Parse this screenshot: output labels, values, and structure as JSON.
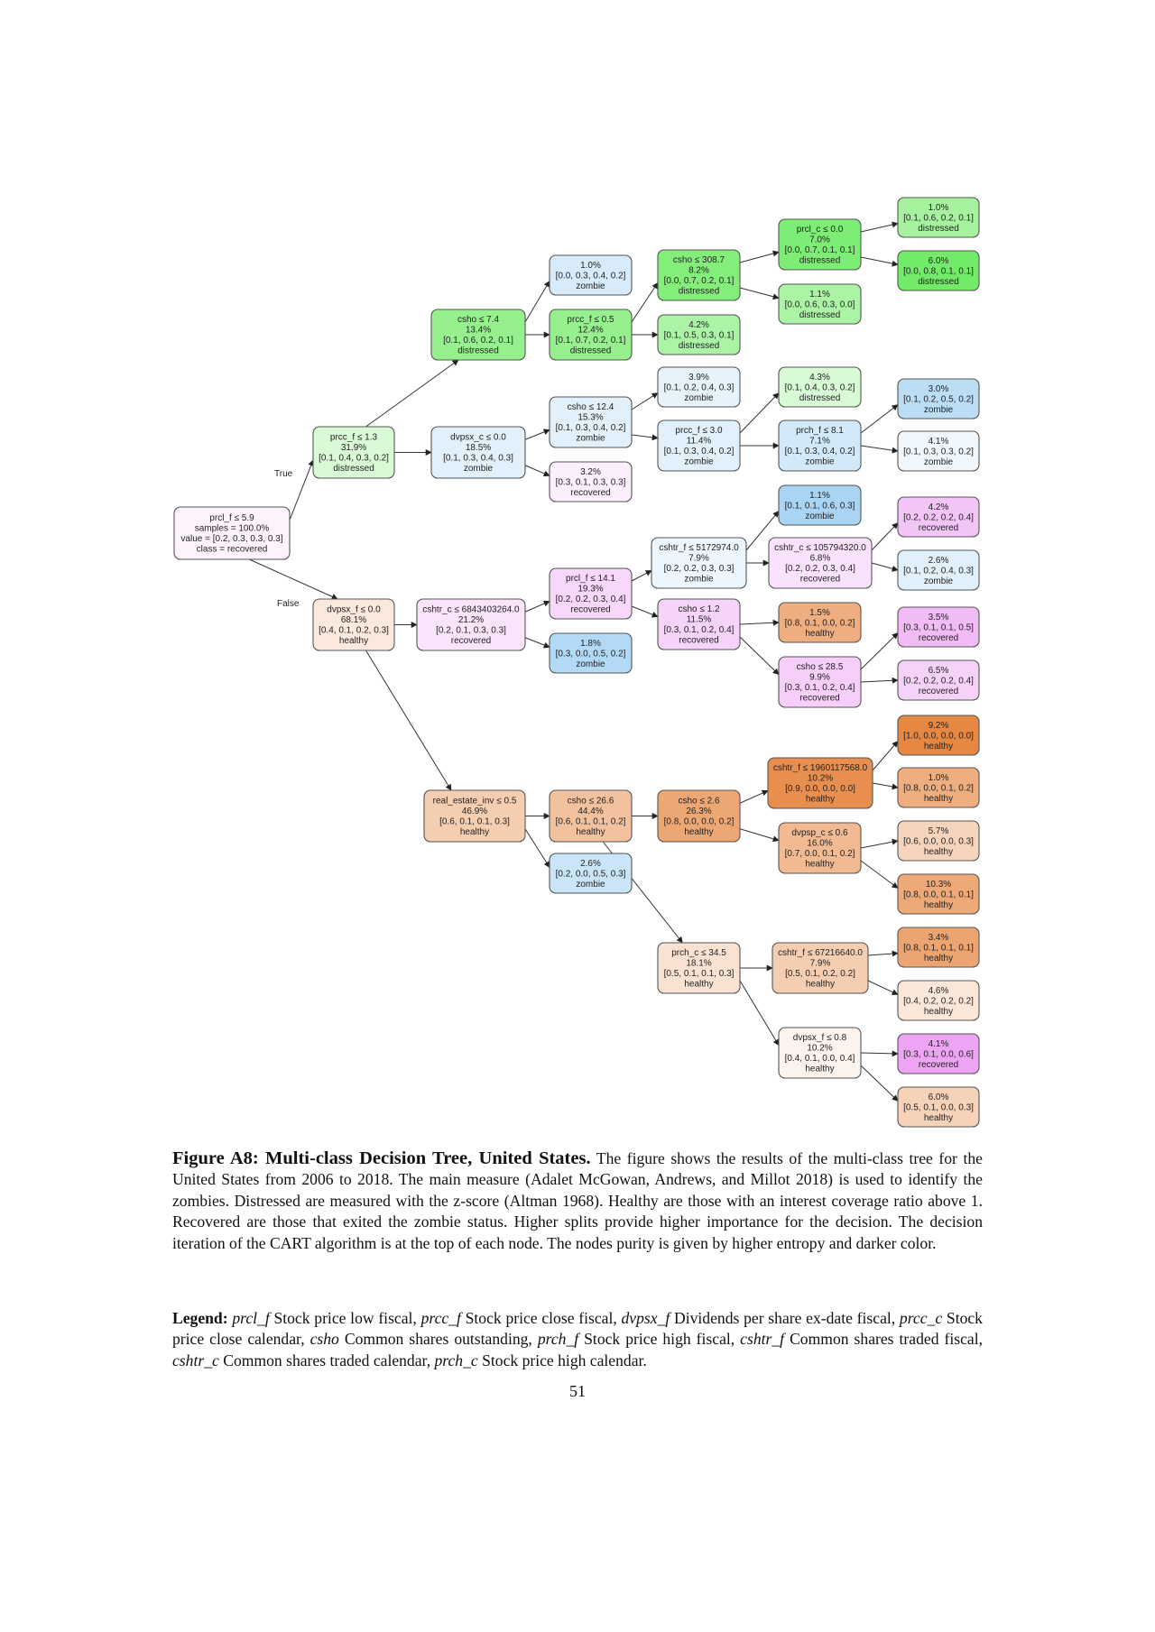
{
  "figure": {
    "title": "Figure A8: Multi-class Decision Tree, United States.",
    "caption": "The figure shows the results of the multi-class tree for the United States from 2006 to 2018. The main measure (Adalet McGowan, Andrews, and Millot 2018) is used to identify the zombies. Distressed are measured with the z-score (Altman 1968). Healthy are those with an interest coverage ratio above 1. Recovered are those that exited the zombie status. Higher splits provide higher importance for the decision. The decision iteration of the CART algorithm is at the top of each node. The nodes purity is given by higher entropy and darker color.",
    "legend_title": "Legend:",
    "legend_items": [
      {
        "var": "prcl_f",
        "desc": "Stock price low fiscal,"
      },
      {
        "var": "prcc_f",
        "desc": "Stock price close fiscal,"
      },
      {
        "var": "dvpsx_f",
        "desc": "Dividends per share ex-date fiscal,"
      },
      {
        "var": "prcc_c",
        "desc": "Stock price close calendar,"
      },
      {
        "var": "csho",
        "desc": "Common shares outstanding,"
      },
      {
        "var": "prch_f",
        "desc": "Stock price high fiscal,"
      },
      {
        "var": "cshtr_f",
        "desc": "Common shares traded fiscal,"
      },
      {
        "var": "cshtr_c",
        "desc": "Common shares traded calendar,"
      },
      {
        "var": "prch_c",
        "desc": "Stock price high calendar."
      }
    ],
    "page_number": "51"
  },
  "class_colors": {
    "healthy": "#e58139",
    "distressed": "#47e539",
    "zombie": "#399de5",
    "recovered": "#d739e5"
  },
  "edge_labels": {
    "true": "True",
    "false": "False"
  },
  "tree": {
    "nodes": [
      {
        "id": "root",
        "lines": [
          "prcl_f ≤ 5.9",
          "samples = 100.0%",
          "value = [0.2, 0.3, 0.3, 0.3]",
          "class = recovered"
        ],
        "class": "recovered",
        "purity": 0.0
      },
      {
        "id": "n1",
        "lines": [
          "prcc_f ≤ 1.3",
          "31.9%",
          "[0.1, 0.4, 0.3, 0.2]",
          "distressed"
        ],
        "class": "distressed",
        "purity": 0.15
      },
      {
        "id": "n2",
        "lines": [
          "dvpsx_f ≤ 0.0",
          "68.1%",
          "[0.4, 0.1, 0.2, 0.3]",
          "healthy"
        ],
        "class": "healthy",
        "purity": 0.12
      },
      {
        "id": "n3",
        "lines": [
          "csho ≤ 7.4",
          "13.4%",
          "[0.1, 0.6, 0.2, 0.1]",
          "distressed"
        ],
        "class": "distressed",
        "purity": 0.55
      },
      {
        "id": "n4",
        "lines": [
          "dvpsx_c ≤ 0.0",
          "18.5%",
          "[0.1, 0.3, 0.4, 0.3]",
          "zombie"
        ],
        "class": "zombie",
        "purity": 0.1
      },
      {
        "id": "n5",
        "lines": [
          "cshtr_c ≤ 6843403264.0",
          "21.2%",
          "[0.2, 0.1, 0.3, 0.3]",
          "recovered"
        ],
        "class": "recovered",
        "purity": 0.08
      },
      {
        "id": "n6",
        "lines": [
          "real_estate_inv ≤ 0.5",
          "46.9%",
          "[0.6, 0.1, 0.1, 0.3]",
          "healthy"
        ],
        "class": "healthy",
        "purity": 0.35
      },
      {
        "id": "n7",
        "lines": [
          "1.0%",
          "[0.0, 0.3, 0.4, 0.2]",
          "zombie"
        ],
        "class": "zombie",
        "purity": 0.15
      },
      {
        "id": "n8",
        "lines": [
          "prcc_f ≤ 0.5",
          "12.4%",
          "[0.1, 0.7, 0.2, 0.1]",
          "distressed"
        ],
        "class": "distressed",
        "purity": 0.55
      },
      {
        "id": "n9",
        "lines": [
          "csho ≤ 12.4",
          "15.3%",
          "[0.1, 0.3, 0.4, 0.2]",
          "zombie"
        ],
        "class": "zombie",
        "purity": 0.1
      },
      {
        "id": "n10",
        "lines": [
          "3.2%",
          "[0.3, 0.1, 0.3, 0.3]",
          "recovered"
        ],
        "class": "recovered",
        "purity": 0.03
      },
      {
        "id": "n11",
        "lines": [
          "prcl_f ≤ 14.1",
          "19.3%",
          "[0.2, 0.2, 0.3, 0.4]",
          "recovered"
        ],
        "class": "recovered",
        "purity": 0.15
      },
      {
        "id": "n12",
        "lines": [
          "1.8%",
          "[0.3, 0.0, 0.5, 0.2]",
          "zombie"
        ],
        "class": "zombie",
        "purity": 0.35
      },
      {
        "id": "n13",
        "lines": [
          "csho ≤ 26.6",
          "44.4%",
          "[0.6, 0.1, 0.1, 0.2]",
          "healthy"
        ],
        "class": "healthy",
        "purity": 0.45
      },
      {
        "id": "n14",
        "lines": [
          "2.6%",
          "[0.2, 0.0, 0.5, 0.3]",
          "zombie"
        ],
        "class": "zombie",
        "purity": 0.22
      },
      {
        "id": "n15",
        "lines": [
          "csho ≤ 308.7",
          "8.2%",
          "[0.0, 0.7, 0.2, 0.1]",
          "distressed"
        ],
        "class": "distressed",
        "purity": 0.65
      },
      {
        "id": "n16",
        "lines": [
          "4.2%",
          "[0.1, 0.5, 0.3, 0.1]",
          "distressed"
        ],
        "class": "distressed",
        "purity": 0.42
      },
      {
        "id": "n17",
        "lines": [
          "3.9%",
          "[0.1, 0.2, 0.4, 0.3]",
          "zombie"
        ],
        "class": "zombie",
        "purity": 0.07
      },
      {
        "id": "n18",
        "lines": [
          "prcc_f ≤ 3.0",
          "11.4%",
          "[0.1, 0.3, 0.4, 0.2]",
          "zombie"
        ],
        "class": "zombie",
        "purity": 0.1
      },
      {
        "id": "n19",
        "lines": [
          "cshtr_f ≤ 5172974.0",
          "7.9%",
          "[0.2, 0.2, 0.3, 0.3]",
          "zombie"
        ],
        "class": "zombie",
        "purity": 0.03
      },
      {
        "id": "n20",
        "lines": [
          "csho ≤ 1.2",
          "11.5%",
          "[0.3, 0.1, 0.2, 0.4]",
          "recovered"
        ],
        "class": "recovered",
        "purity": 0.17
      },
      {
        "id": "n21",
        "lines": [
          "csho ≤ 2.6",
          "26.3%",
          "[0.8, 0.0, 0.0, 0.2]",
          "healthy"
        ],
        "class": "healthy",
        "purity": 0.68
      },
      {
        "id": "n22",
        "lines": [
          "prch_c ≤ 34.5",
          "18.1%",
          "[0.5, 0.1, 0.1, 0.3]",
          "healthy"
        ],
        "class": "healthy",
        "purity": 0.18
      },
      {
        "id": "n23",
        "lines": [
          "prcl_c ≤ 0.0",
          "7.0%",
          "[0.0, 0.7, 0.1, 0.1]",
          "distressed"
        ],
        "class": "distressed",
        "purity": 0.68
      },
      {
        "id": "n24",
        "lines": [
          "1.1%",
          "[0.0, 0.6, 0.3, 0.0]",
          "distressed"
        ],
        "class": "distressed",
        "purity": 0.42
      },
      {
        "id": "n25",
        "lines": [
          "4.3%",
          "[0.1, 0.4, 0.3, 0.2]",
          "distressed"
        ],
        "class": "distressed",
        "purity": 0.16
      },
      {
        "id": "n26",
        "lines": [
          "prch_f ≤ 8.1",
          "7.1%",
          "[0.1, 0.3, 0.4, 0.2]",
          "zombie"
        ],
        "class": "zombie",
        "purity": 0.18
      },
      {
        "id": "n27",
        "lines": [
          "1.1%",
          "[0.1, 0.1, 0.6, 0.3]",
          "zombie"
        ],
        "class": "zombie",
        "purity": 0.4
      },
      {
        "id": "n28",
        "lines": [
          "cshtr_c ≤ 105794320.0",
          "6.8%",
          "[0.2, 0.2, 0.3, 0.4]",
          "recovered"
        ],
        "class": "recovered",
        "purity": 0.09
      },
      {
        "id": "n29",
        "lines": [
          "1.5%",
          "[0.8, 0.1, 0.0, 0.2]",
          "healthy"
        ],
        "class": "healthy",
        "purity": 0.62
      },
      {
        "id": "n30",
        "lines": [
          "csho ≤ 28.5",
          "9.9%",
          "[0.3, 0.1, 0.2, 0.4]",
          "recovered"
        ],
        "class": "recovered",
        "purity": 0.2
      },
      {
        "id": "n31",
        "lines": [
          "cshtr_f ≤ 1960117568.0",
          "10.2%",
          "[0.9, 0.0, 0.0, 0.0]",
          "healthy"
        ],
        "class": "healthy",
        "purity": 0.88
      },
      {
        "id": "n32",
        "lines": [
          "dvpsp_c ≤ 0.6",
          "16.0%",
          "[0.7, 0.0, 0.1, 0.2]",
          "healthy"
        ],
        "class": "healthy",
        "purity": 0.52
      },
      {
        "id": "n33",
        "lines": [
          "cshtr_f ≤ 67216640.0",
          "7.9%",
          "[0.5, 0.1, 0.2, 0.2]",
          "healthy"
        ],
        "class": "healthy",
        "purity": 0.35
      },
      {
        "id": "n34",
        "lines": [
          "dvpsx_f ≤ 0.8",
          "10.2%",
          "[0.4, 0.1, 0.0, 0.4]",
          "healthy"
        ],
        "class": "healthy",
        "purity": 0.04
      },
      {
        "id": "n35",
        "lines": [
          "1.0%",
          "[0.1, 0.6, 0.2, 0.1]",
          "distressed"
        ],
        "class": "distressed",
        "purity": 0.45
      },
      {
        "id": "n36",
        "lines": [
          "6.0%",
          "[0.0, 0.8, 0.1, 0.1]",
          "distressed"
        ],
        "class": "distressed",
        "purity": 0.75
      },
      {
        "id": "n37",
        "lines": [
          "3.0%",
          "[0.1, 0.2, 0.5, 0.2]",
          "zombie"
        ],
        "class": "zombie",
        "purity": 0.3
      },
      {
        "id": "n38",
        "lines": [
          "4.1%",
          "[0.1, 0.3, 0.3, 0.2]",
          "zombie"
        ],
        "class": "zombie",
        "purity": 0.02
      },
      {
        "id": "n39",
        "lines": [
          "4.2%",
          "[0.2, 0.2, 0.2, 0.4]",
          "recovered"
        ],
        "class": "recovered",
        "purity": 0.25
      },
      {
        "id": "n40",
        "lines": [
          "2.6%",
          "[0.1, 0.2, 0.4, 0.3]",
          "zombie"
        ],
        "class": "zombie",
        "purity": 0.1
      },
      {
        "id": "n41",
        "lines": [
          "3.5%",
          "[0.3, 0.1, 0.1, 0.5]",
          "recovered"
        ],
        "class": "recovered",
        "purity": 0.3
      },
      {
        "id": "n42",
        "lines": [
          "6.5%",
          "[0.2, 0.2, 0.2, 0.4]",
          "recovered"
        ],
        "class": "recovered",
        "purity": 0.18
      },
      {
        "id": "n43",
        "lines": [
          "9.2%",
          "[1.0, 0.0, 0.0, 0.0]",
          "healthy"
        ],
        "class": "healthy",
        "purity": 0.95
      },
      {
        "id": "n44",
        "lines": [
          "1.0%",
          "[0.8, 0.0, 0.1, 0.2]",
          "healthy"
        ],
        "class": "healthy",
        "purity": 0.62
      },
      {
        "id": "n45",
        "lines": [
          "5.7%",
          "[0.6, 0.0, 0.0, 0.3]",
          "healthy"
        ],
        "class": "healthy",
        "purity": 0.3
      },
      {
        "id": "n46",
        "lines": [
          "10.3%",
          "[0.8, 0.0, 0.1, 0.1]",
          "healthy"
        ],
        "class": "healthy",
        "purity": 0.66
      },
      {
        "id": "n47",
        "lines": [
          "3.4%",
          "[0.8, 0.1, 0.1, 0.1]",
          "healthy"
        ],
        "class": "healthy",
        "purity": 0.7
      },
      {
        "id": "n48",
        "lines": [
          "4.6%",
          "[0.4, 0.2, 0.2, 0.2]",
          "healthy"
        ],
        "class": "healthy",
        "purity": 0.14
      },
      {
        "id": "n49",
        "lines": [
          "4.1%",
          "[0.3, 0.1, 0.0, 0.6]",
          "recovered"
        ],
        "class": "recovered",
        "purity": 0.42
      },
      {
        "id": "n50",
        "lines": [
          "6.0%",
          "[0.5, 0.1, 0.0, 0.3]",
          "healthy"
        ],
        "class": "healthy",
        "purity": 0.32
      }
    ],
    "edges": [
      {
        "from": "root",
        "to": "n1",
        "label": "true"
      },
      {
        "from": "root",
        "to": "n2",
        "label": "false"
      },
      {
        "from": "n1",
        "to": "n3"
      },
      {
        "from": "n1",
        "to": "n4"
      },
      {
        "from": "n2",
        "to": "n5"
      },
      {
        "from": "n2",
        "to": "n6"
      },
      {
        "from": "n3",
        "to": "n7"
      },
      {
        "from": "n3",
        "to": "n8"
      },
      {
        "from": "n4",
        "to": "n9"
      },
      {
        "from": "n4",
        "to": "n10"
      },
      {
        "from": "n5",
        "to": "n11"
      },
      {
        "from": "n5",
        "to": "n12"
      },
      {
        "from": "n6",
        "to": "n13"
      },
      {
        "from": "n6",
        "to": "n14"
      },
      {
        "from": "n8",
        "to": "n15"
      },
      {
        "from": "n8",
        "to": "n16"
      },
      {
        "from": "n9",
        "to": "n17"
      },
      {
        "from": "n9",
        "to": "n18"
      },
      {
        "from": "n11",
        "to": "n19"
      },
      {
        "from": "n11",
        "to": "n20"
      },
      {
        "from": "n13",
        "to": "n21"
      },
      {
        "from": "n13",
        "to": "n22"
      },
      {
        "from": "n15",
        "to": "n23"
      },
      {
        "from": "n15",
        "to": "n24"
      },
      {
        "from": "n18",
        "to": "n25"
      },
      {
        "from": "n18",
        "to": "n26"
      },
      {
        "from": "n19",
        "to": "n27"
      },
      {
        "from": "n19",
        "to": "n28"
      },
      {
        "from": "n20",
        "to": "n29"
      },
      {
        "from": "n20",
        "to": "n30"
      },
      {
        "from": "n21",
        "to": "n31"
      },
      {
        "from": "n21",
        "to": "n32"
      },
      {
        "from": "n22",
        "to": "n33"
      },
      {
        "from": "n22",
        "to": "n34"
      },
      {
        "from": "n23",
        "to": "n35"
      },
      {
        "from": "n23",
        "to": "n36"
      },
      {
        "from": "n26",
        "to": "n37"
      },
      {
        "from": "n26",
        "to": "n38"
      },
      {
        "from": "n28",
        "to": "n39"
      },
      {
        "from": "n28",
        "to": "n40"
      },
      {
        "from": "n30",
        "to": "n41"
      },
      {
        "from": "n30",
        "to": "n42"
      },
      {
        "from": "n31",
        "to": "n43"
      },
      {
        "from": "n31",
        "to": "n44"
      },
      {
        "from": "n32",
        "to": "n45"
      },
      {
        "from": "n32",
        "to": "n46"
      },
      {
        "from": "n33",
        "to": "n47"
      },
      {
        "from": "n33",
        "to": "n48"
      },
      {
        "from": "n34",
        "to": "n49"
      },
      {
        "from": "n34",
        "to": "n50"
      }
    ]
  }
}
